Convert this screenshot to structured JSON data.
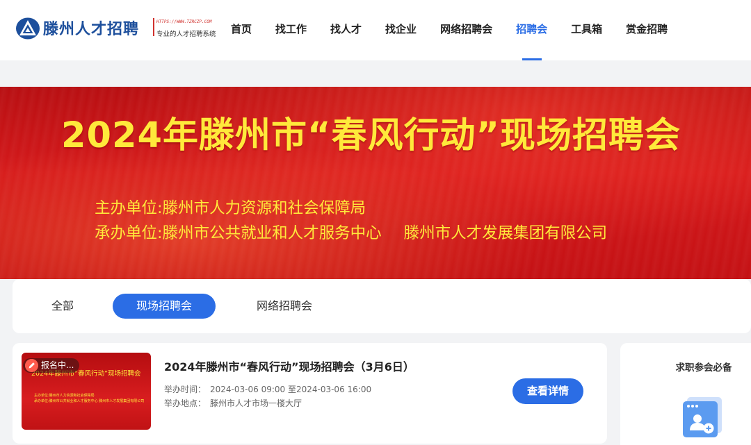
{
  "header": {
    "logo": {
      "name": "滕州人才招聘",
      "url": "HTTPS://WWW.TZRCZP.COM",
      "slogan": "专业的人才招聘系统"
    },
    "nav": [
      {
        "label": "首页"
      },
      {
        "label": "找工作"
      },
      {
        "label": "找人才"
      },
      {
        "label": "找企业"
      },
      {
        "label": "网络招聘会"
      },
      {
        "label": "招聘会",
        "active": true
      },
      {
        "label": "工具箱"
      },
      {
        "label": "赏金招聘"
      }
    ],
    "active_color": "#2b6de5"
  },
  "banner": {
    "title": "2024年滕州市“春风行动”现场招聘会",
    "host_line": "主办单位:滕州市人力资源和社会保障局",
    "organizer_line_a": "承办单位:滕州市公共就业和人才服务中心",
    "organizer_line_b": "滕州市人才发展集团有限公司",
    "text_color": "#ffe93b",
    "bg_color": "#d5191b"
  },
  "filter_tabs": [
    {
      "label": "全部"
    },
    {
      "label": "现场招聘会",
      "selected": true
    },
    {
      "label": "网络招聘会"
    }
  ],
  "fair": {
    "badge": "报名中...",
    "thumb_title": "2024年滕州市“春风行动”现场招聘会",
    "thumb_host": "主办单位:滕州市人力资源和社会保障局",
    "thumb_organizer": "承办单位:滕州市公共就业和人才服务中心   滕州市人才发展集团有限公司",
    "title": "2024年滕州市“春风行动”现场招聘会（3月6日）",
    "time_label": "举办时间：",
    "time_value": "2024-03-06 09:00 至2024-03-06 16:00",
    "place_label": "举办地点：",
    "place_value": "滕州市人才市场一楼大厅",
    "detail_button": "查看详情"
  },
  "side": {
    "title": "求职参会必备",
    "icon": "user-add-window-icon"
  }
}
